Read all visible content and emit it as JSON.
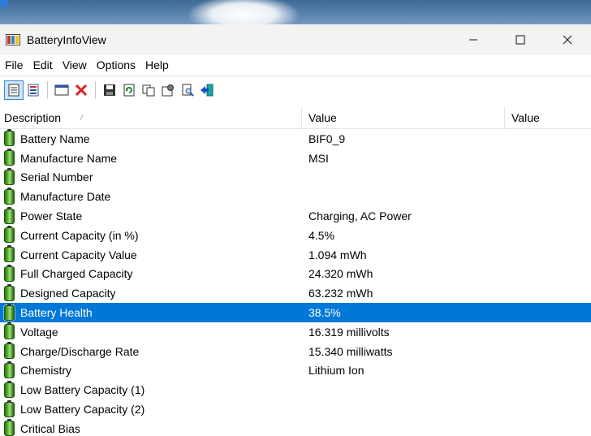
{
  "window": {
    "title": "BatteryInfoView",
    "minimize": "—",
    "maximize": "☐",
    "close": "✕"
  },
  "menu": [
    "File",
    "Edit",
    "View",
    "Options",
    "Help"
  ],
  "columns": {
    "description": "Description",
    "value": "Value",
    "value2": "Value",
    "sort_indicator": "⁄"
  },
  "rows": [
    {
      "label": "Battery Name",
      "value": "BIF0_9",
      "selected": false
    },
    {
      "label": "Manufacture Name",
      "value": "MSI",
      "selected": false
    },
    {
      "label": "Serial Number",
      "value": "",
      "selected": false
    },
    {
      "label": "Manufacture Date",
      "value": "",
      "selected": false
    },
    {
      "label": "Power State",
      "value": "Charging, AC Power",
      "selected": false
    },
    {
      "label": "Current Capacity (in %)",
      "value": "4.5%",
      "selected": false
    },
    {
      "label": "Current Capacity Value",
      "value": "1.094 mWh",
      "selected": false
    },
    {
      "label": "Full Charged Capacity",
      "value": "24.320 mWh",
      "selected": false
    },
    {
      "label": "Designed Capacity",
      "value": "63.232 mWh",
      "selected": false
    },
    {
      "label": "Battery Health",
      "value": "38.5%",
      "selected": true
    },
    {
      "label": "Voltage",
      "value": "16.319 millivolts",
      "selected": false
    },
    {
      "label": "Charge/Discharge Rate",
      "value": "15.340 milliwatts",
      "selected": false
    },
    {
      "label": "Chemistry",
      "value": "Lithium Ion",
      "selected": false
    },
    {
      "label": "Low Battery Capacity (1)",
      "value": "",
      "selected": false
    },
    {
      "label": "Low Battery Capacity (2)",
      "value": "",
      "selected": false
    },
    {
      "label": "Critical Bias",
      "value": "",
      "selected": false
    }
  ],
  "colors": {
    "selection": "#0078d7",
    "battery_green": "#5fb83a"
  }
}
